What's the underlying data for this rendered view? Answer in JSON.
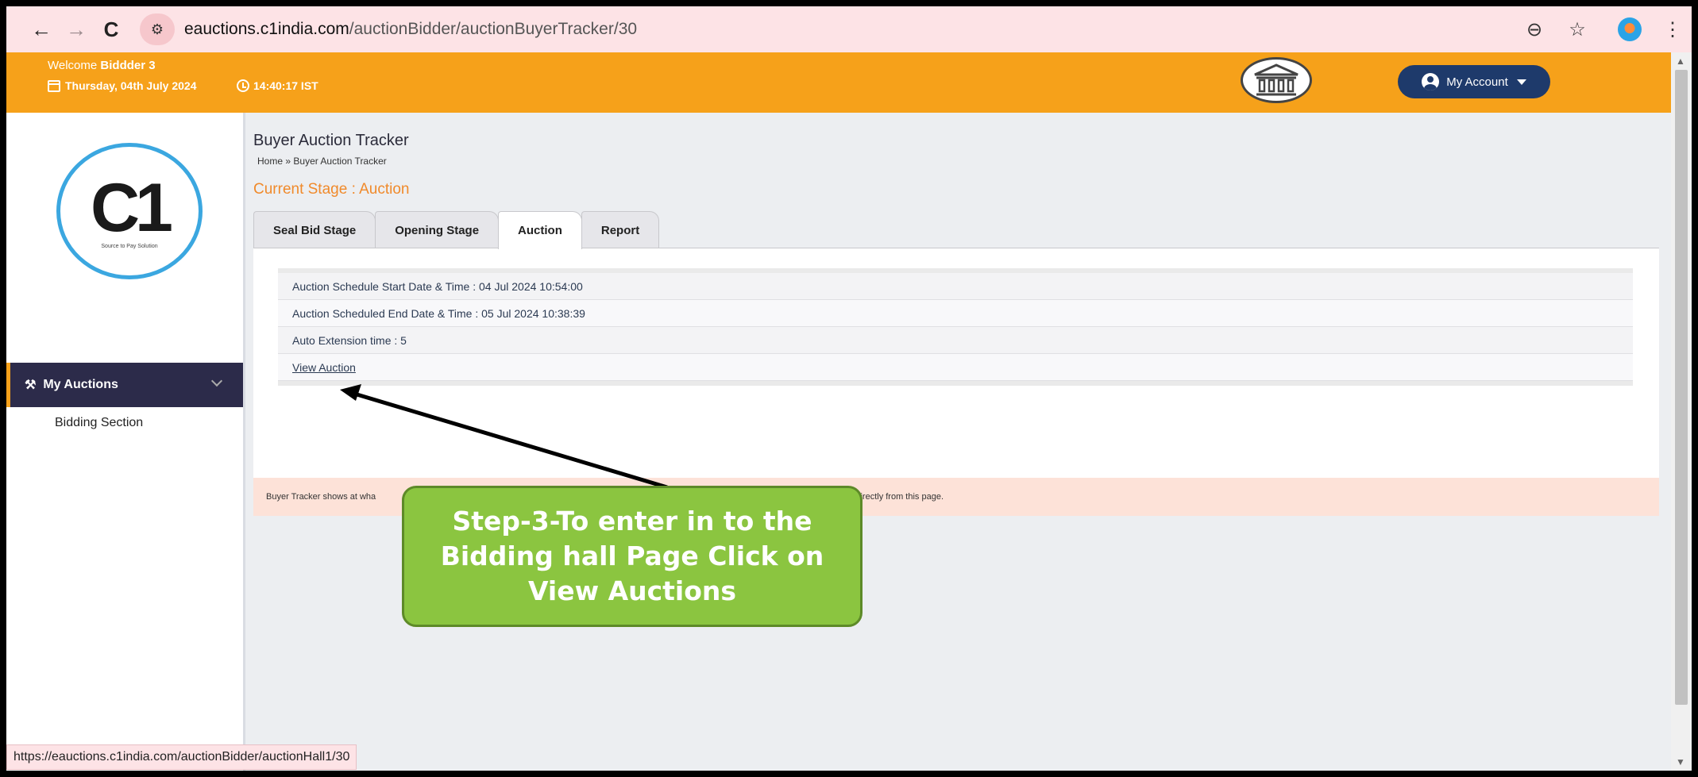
{
  "browser": {
    "url_domain": "eauctions.c1india.com",
    "url_path": "/auctionBidder/auctionBuyerTracker/30",
    "back_icon": "←",
    "forward_icon": "→",
    "reload_icon": "C",
    "site_info_icon": "⚙",
    "zoom_icon": "⊖",
    "star_icon": "☆",
    "menu_icon": "⋮"
  },
  "header": {
    "welcome_prefix": "Welcome",
    "user_name": "Biddder 3",
    "date": "Thursday, 04th July 2024",
    "time": "14:40:17 IST",
    "account_label": "My Account",
    "accent_color": "#f6a11a",
    "account_color": "#1e3a6b"
  },
  "sidebar": {
    "brand_mark": "C1",
    "brand_tagline": "Source to Pay Solution",
    "active_menu": "My Auctions",
    "sub_item": "Bidding Section"
  },
  "main": {
    "title": "Buyer Auction Tracker",
    "breadcrumb": {
      "home": "Home",
      "separator": "»",
      "current": "Buyer Auction Tracker"
    },
    "stage_label": "Current Stage : Auction",
    "tabs": [
      {
        "label": "Seal Bid Stage"
      },
      {
        "label": "Opening Stage"
      },
      {
        "label": "Auction"
      },
      {
        "label": "Report"
      }
    ],
    "info_rows": {
      "start": "Auction Schedule Start Date & Time : 04 Jul 2024 10:54:00",
      "end": "Auction Scheduled End Date & Time : 05 Jul 2024 10:38:39",
      "extension": "Auto Extension time : 5",
      "view_link": "View Auction"
    },
    "note_left": "Buyer Tracker shows at wha",
    "note_right": "e directly from this page."
  },
  "status_bar": {
    "url": "https://eauctions.c1india.com/auctionBidder/auctionHall1/30"
  },
  "annotation": {
    "text": "Step-3-To enter in to the Bidding hall Page Click on View Auctions",
    "color": "#8bc540"
  }
}
